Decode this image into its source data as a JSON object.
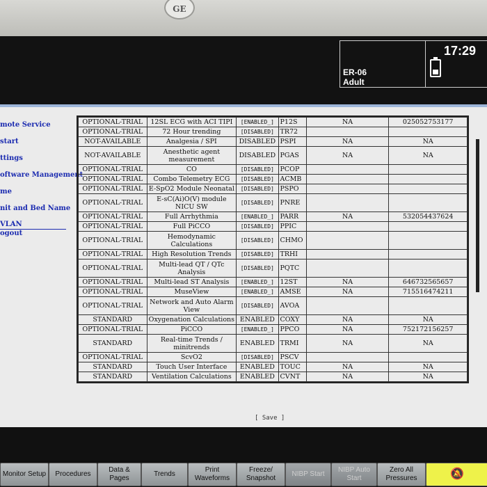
{
  "header": {
    "logo": "GE",
    "bed": "ER-06",
    "patient_type": "Adult",
    "time": "17:29"
  },
  "sidebar": {
    "items": [
      "mote Service",
      "start",
      "ttings",
      "oftware Management",
      "me",
      "nit and Bed Name",
      "VLAN",
      "ogout"
    ]
  },
  "table": {
    "rows": [
      [
        "OPTIONAL-TRIAL",
        "12SL ECG with ACI TIPI",
        "[ENABLED_]",
        "P12S",
        "NA",
        "025052753177"
      ],
      [
        "OPTIONAL-TRIAL",
        "72 Hour trending",
        "[DISABLED]",
        "TR72",
        "",
        ""
      ],
      [
        "NOT-AVAILABLE",
        "Analgesia / SPI",
        "DISABLED",
        "PSPI",
        "NA",
        "NA"
      ],
      [
        "NOT-AVAILABLE",
        "Anesthetic agent measurement",
        "DISABLED",
        "PGAS",
        "NA",
        "NA"
      ],
      [
        "OPTIONAL-TRIAL",
        "CO",
        "[DISABLED]",
        "PCOP",
        "",
        ""
      ],
      [
        "OPTIONAL-TRIAL",
        "Combo Telemetry ECG",
        "[DISABLED]",
        "ACMB",
        "",
        ""
      ],
      [
        "OPTIONAL-TRIAL",
        "E-SpO2 Module Neonatal",
        "[DISABLED]",
        "PSPO",
        "",
        ""
      ],
      [
        "OPTIONAL-TRIAL",
        "E-sC(Ai)O(V) module NICU SW",
        "[DISABLED]",
        "PNRE",
        "",
        ""
      ],
      [
        "OPTIONAL-TRIAL",
        "Full Arrhythmia",
        "[ENABLED_]",
        "PARR",
        "NA",
        "532054437624"
      ],
      [
        "OPTIONAL-TRIAL",
        "Full PiCCO",
        "[DISABLED]",
        "PPIC",
        "",
        ""
      ],
      [
        "OPTIONAL-TRIAL",
        "Hemodynamic Calculations",
        "[DISABLED]",
        "CHMO",
        "",
        ""
      ],
      [
        "OPTIONAL-TRIAL",
        "High Resolution Trends",
        "[DISABLED]",
        "TRHI",
        "",
        ""
      ],
      [
        "OPTIONAL-TRIAL",
        "Multi-lead QT / QTc Analysis",
        "[DISABLED]",
        "PQTC",
        "",
        ""
      ],
      [
        "OPTIONAL-TRIAL",
        "Multi-lead ST Analysis",
        "[ENABLED_]",
        "12ST",
        "NA",
        "646732565657"
      ],
      [
        "OPTIONAL-TRIAL",
        "MuseView",
        "[ENABLED_]",
        "AMSE",
        "NA",
        "715516474211"
      ],
      [
        "OPTIONAL-TRIAL",
        "Network and Auto Alarm View",
        "[DISABLED]",
        "AVOA",
        "",
        ""
      ],
      [
        "STANDARD",
        "Oxygenation Calculations",
        "ENABLED",
        "COXY",
        "NA",
        "NA"
      ],
      [
        "OPTIONAL-TRIAL",
        "PiCCO",
        "[ENABLED_]",
        "PPCO",
        "NA",
        "752172156257"
      ],
      [
        "STANDARD",
        "Real-time Trends / minitrends",
        "ENABLED",
        "TRMI",
        "NA",
        "NA"
      ],
      [
        "OPTIONAL-TRIAL",
        "ScvO2",
        "[DISABLED]",
        "PSCV",
        "",
        ""
      ],
      [
        "STANDARD",
        "Touch User Interface",
        "ENABLED",
        "TOUC",
        "NA",
        "NA"
      ],
      [
        "STANDARD",
        "Ventilation Calculations",
        "ENABLED",
        "CVNT",
        "NA",
        "NA"
      ]
    ]
  },
  "save_label": "[ Save ]",
  "bottom_buttons": [
    {
      "label": "Monitor Setup",
      "disabled": false
    },
    {
      "label": "Procedures",
      "disabled": false
    },
    {
      "label": "Data & Pages",
      "disabled": false
    },
    {
      "label": "Trends",
      "disabled": false
    },
    {
      "label": "Print Waveforms",
      "disabled": false
    },
    {
      "label": "Freeze/ Snapshot",
      "disabled": false
    },
    {
      "label": "NIBP Start",
      "disabled": true
    },
    {
      "label": "NIBP Auto Start",
      "disabled": true
    },
    {
      "label": "Zero All Pressures",
      "disabled": false
    },
    {
      "label": "",
      "icon": "alarm-silence-icon",
      "disabled": false
    }
  ],
  "colors": {
    "sidebar_link": "#1b2bb0",
    "alarm_button": "#eef24a",
    "panel_background": "#ebebeb"
  }
}
